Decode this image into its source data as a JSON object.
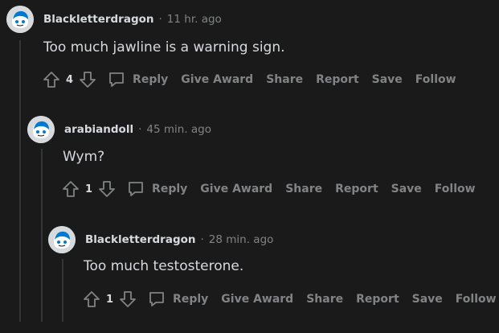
{
  "comments": [
    {
      "author": "Blackletterdragon",
      "separator": "·",
      "time": "11 hr. ago",
      "text": "Too much jawline is a warning sign.",
      "score": "4",
      "actions": {
        "reply": "Reply",
        "give_award": "Give Award",
        "share": "Share",
        "report": "Report",
        "save": "Save",
        "follow": "Follow"
      }
    },
    {
      "author": "arabiandoll",
      "separator": "·",
      "time": "45 min. ago",
      "text": "Wym?",
      "score": "1",
      "actions": {
        "reply": "Reply",
        "give_award": "Give Award",
        "share": "Share",
        "report": "Report",
        "save": "Save",
        "follow": "Follow"
      }
    },
    {
      "author": "Blackletterdragon",
      "separator": "·",
      "time": "28 min. ago",
      "text": "Too much testosterone.",
      "score": "1",
      "actions": {
        "reply": "Reply",
        "give_award": "Give Award",
        "share": "Share",
        "report": "Report",
        "save": "Save",
        "follow": "Follow"
      }
    }
  ],
  "colors": {
    "background": "#1a1a1b",
    "text": "#d7dadc",
    "muted": "#818384",
    "avatar_accent": "#0079d3",
    "thread_line": "#343536"
  },
  "icons": [
    "snoo-avatar-icon",
    "upvote-icon",
    "downvote-icon",
    "comment-bubble-icon"
  ]
}
